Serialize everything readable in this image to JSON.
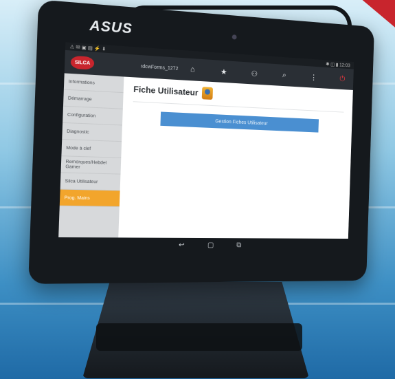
{
  "device": {
    "brand": "ASUS"
  },
  "statusbar": {
    "left": "⚠ ✉ ▣ ▤ ⚡ ⬇",
    "right": "✱ ◫ ▮ 12:03"
  },
  "appbar": {
    "logo_text": "SILCA",
    "title": "rdcwForms_1272",
    "icons": [
      "home-icon",
      "star-icon",
      "people-icon",
      "search-icon",
      "more-icon",
      "power-icon"
    ]
  },
  "sidebar": {
    "items": [
      {
        "label": "Informations"
      },
      {
        "label": "Démarrage"
      },
      {
        "label": "Configuration"
      },
      {
        "label": "Diagnostic"
      },
      {
        "label": "Mode à clef"
      },
      {
        "label": "Remorques/Hebdel Gamer"
      },
      {
        "label": "Silca Utilisateur"
      },
      {
        "label": "Prog. Mains"
      }
    ],
    "active_index": 7
  },
  "main": {
    "title": "Fiche Utilisateur",
    "button_label": "Gestion Fiches Utilisateur"
  },
  "navbar": {
    "icons": [
      "back-icon",
      "home-nav-icon",
      "recent-apps-icon"
    ]
  }
}
